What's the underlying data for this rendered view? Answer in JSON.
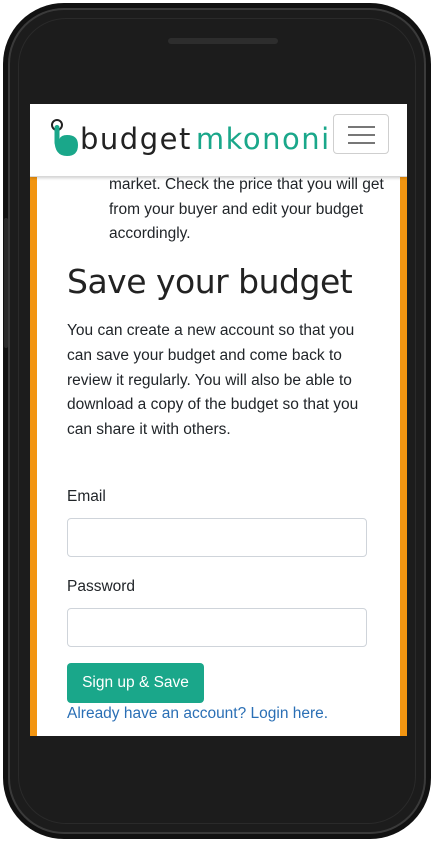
{
  "brand": {
    "name_part1": "budget",
    "name_part2": "mkononi",
    "accent_color": "#1aa78a",
    "page_background": "#f29511"
  },
  "navbar": {
    "menu_icon": "hamburger-icon"
  },
  "list_item_text": "market. Check the price that you will get from your buyer and edit your budget accordingly.",
  "save_section": {
    "heading": "Save your budget",
    "description": "You can create a new account so that you can save your budget and come back to review it regularly. You will also be able to download a copy of the budget so that you can share it with others.",
    "email_label": "Email",
    "email_value": "",
    "password_label": "Password",
    "password_value": "",
    "submit_label": "Sign up & Save",
    "login_link": "Already have an account? Login here."
  }
}
